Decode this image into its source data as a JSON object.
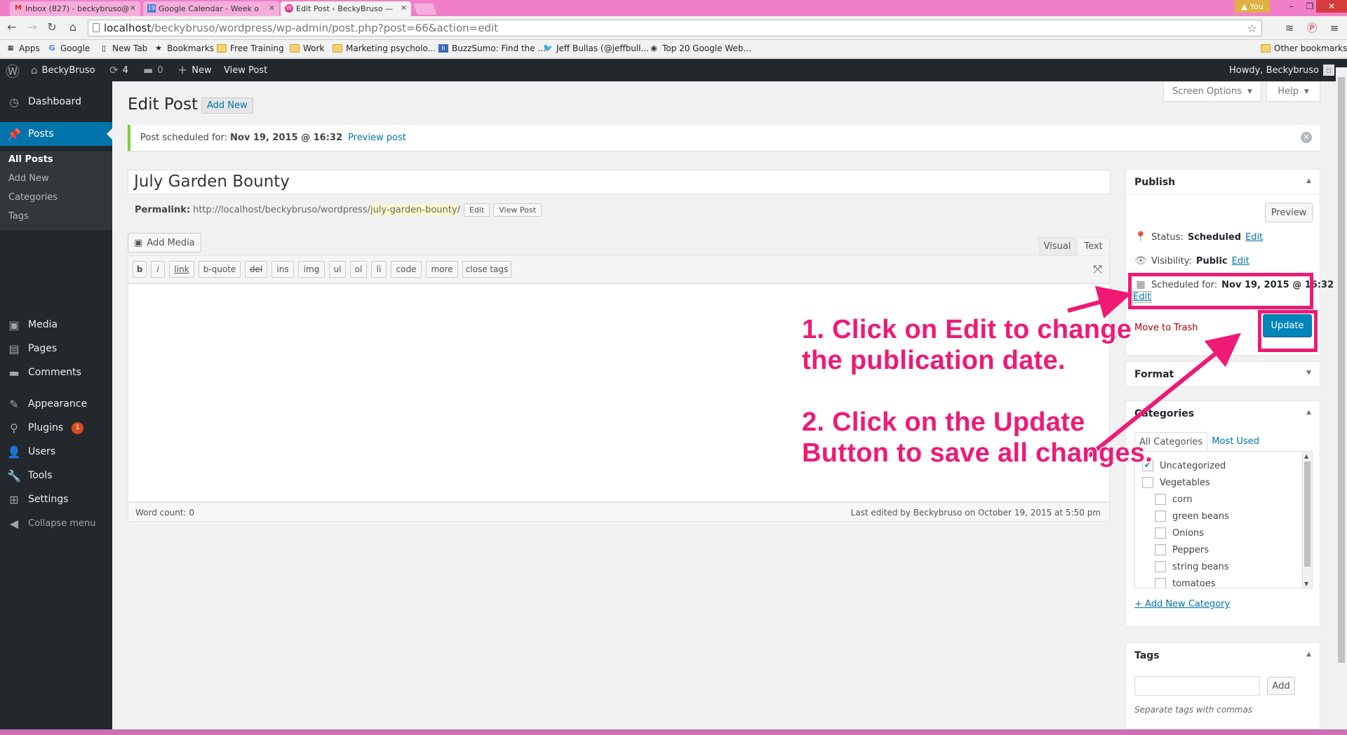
{
  "browser": {
    "tabs": [
      {
        "icon": "gmail-icon",
        "title": "Inbox (827) - beckybruso@",
        "active": false
      },
      {
        "icon": "calendar-icon",
        "title": "Google Calendar - Week o",
        "active": false
      },
      {
        "icon": "wordpress-icon",
        "title": "Edit Post ‹ BeckyBruso —",
        "active": true
      }
    ],
    "profile_label": "You",
    "url_host": "localhost",
    "url_path": "/beckybruso/wordpress/wp-admin/post.php?post=66&action=edit",
    "bookmarks": [
      {
        "label": "Apps",
        "icon": "apps-grid-icon"
      },
      {
        "label": "Google",
        "icon": "google-icon"
      },
      {
        "label": "New Tab",
        "icon": "page-icon"
      },
      {
        "label": "Bookmarks",
        "icon": "star-icon"
      },
      {
        "label": "Free Training",
        "icon": "folder-icon"
      },
      {
        "label": "Work",
        "icon": "folder-icon"
      },
      {
        "label": "Marketing psycholo...",
        "icon": "folder-icon"
      },
      {
        "label": "BuzzSumo: Find the ...",
        "icon": "buzzsumo-icon"
      },
      {
        "label": "Jeff Bullas (@jeffbull...",
        "icon": "twitter-icon"
      },
      {
        "label": "Top 20 Google Web...",
        "icon": "site-icon"
      }
    ],
    "other_bookmarks": "Other bookmarks"
  },
  "adminbar": {
    "site_name": "BeckyBruso",
    "updates_count": "4",
    "comments_count": "0",
    "new_label": "New",
    "view_post": "View Post",
    "howdy": "Howdy, Beckybruso"
  },
  "sidebar": {
    "items": [
      {
        "label": "Dashboard",
        "icon": "dashboard-icon"
      },
      {
        "label": "Posts",
        "icon": "pushpin-icon"
      },
      {
        "label": "Media",
        "icon": "media-icon"
      },
      {
        "label": "Pages",
        "icon": "pages-icon"
      },
      {
        "label": "Comments",
        "icon": "comments-icon"
      },
      {
        "label": "Appearance",
        "icon": "brush-icon"
      },
      {
        "label": "Plugins",
        "icon": "plugin-icon",
        "badge": "1"
      },
      {
        "label": "Users",
        "icon": "users-icon"
      },
      {
        "label": "Tools",
        "icon": "wrench-icon"
      },
      {
        "label": "Settings",
        "icon": "settings-icon"
      },
      {
        "label": "Collapse menu",
        "icon": "collapse-icon"
      }
    ],
    "posts_submenu": [
      "All Posts",
      "Add New",
      "Categories",
      "Tags"
    ]
  },
  "header": {
    "title": "Edit Post",
    "add_new": "Add New",
    "screen_options": "Screen Options",
    "help": "Help"
  },
  "notice": {
    "prefix": "Post scheduled for:",
    "date": "Nov 19, 2015 @ 16:32",
    "link": "Preview post"
  },
  "editor": {
    "post_title": "July Garden Bounty",
    "permalink_label": "Permalink:",
    "permalink_base": "http://localhost/beckybruso/wordpress/",
    "permalink_slug": "july-garden-bounty",
    "permalink_edit": "Edit",
    "view_post": "View Post",
    "add_media": "Add Media",
    "tab_visual": "Visual",
    "tab_text": "Text",
    "quicktags": [
      "b",
      "i",
      "link",
      "b-quote",
      "del",
      "ins",
      "img",
      "ul",
      "ol",
      "li",
      "code",
      "more",
      "close tags"
    ],
    "word_count": "Word count: 0",
    "last_edited": "Last edited by Beckybruso on October 19, 2015 at 5:50 pm"
  },
  "publish": {
    "title": "Publish",
    "preview": "Preview",
    "status_label": "Status:",
    "status_value": "Scheduled",
    "visibility_label": "Visibility:",
    "visibility_value": "Public",
    "scheduled_label": "Scheduled for:",
    "scheduled_value": "Nov 19, 2015 @ 16:32",
    "edit": "Edit",
    "trash": "Move to Trash",
    "update": "Update"
  },
  "format": {
    "title": "Format"
  },
  "categories": {
    "title": "Categories",
    "tab_all": "All Categories",
    "tab_used": "Most Used",
    "items": [
      {
        "label": "Uncategorized",
        "checked": true,
        "level": 0
      },
      {
        "label": "Vegetables",
        "checked": false,
        "level": 0
      },
      {
        "label": "corn",
        "checked": false,
        "level": 1
      },
      {
        "label": "green beans",
        "checked": false,
        "level": 1
      },
      {
        "label": "Onions",
        "checked": false,
        "level": 1
      },
      {
        "label": "Peppers",
        "checked": false,
        "level": 1
      },
      {
        "label": "string beans",
        "checked": false,
        "level": 1
      },
      {
        "label": "tomatoes",
        "checked": false,
        "level": 1
      }
    ],
    "add_new": "+ Add New Category"
  },
  "tags": {
    "title": "Tags",
    "add": "Add",
    "note": "Separate tags with commas"
  },
  "annotations": {
    "step1_line1": "1.  Click on Edit to change",
    "step1_line2": "the publication date.",
    "step2_line1": "2. Click on the Update",
    "step2_line2": "Button to save all changes.",
    "color": "#ee1a76"
  }
}
